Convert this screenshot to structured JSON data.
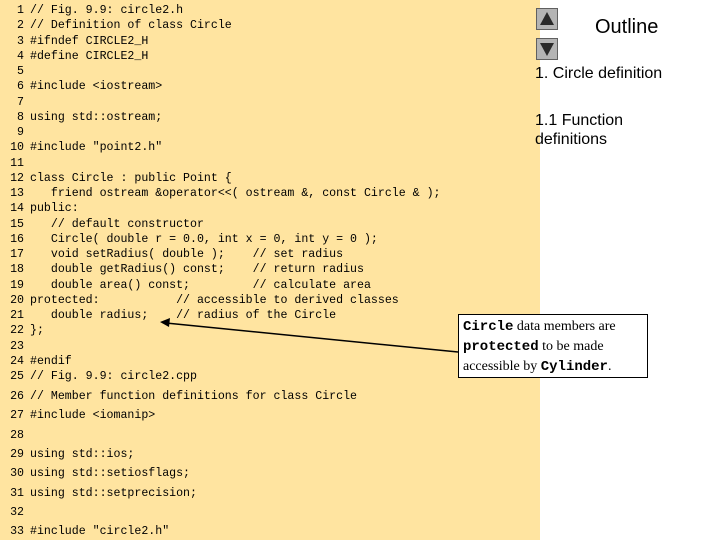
{
  "code": {
    "lines": [
      {
        "n": "1",
        "t": "// Fig. 9.9: circle2.h"
      },
      {
        "n": "2",
        "t": "// Definition of class Circle"
      },
      {
        "n": "3",
        "t": "#ifndef CIRCLE2_H"
      },
      {
        "n": "4",
        "t": "#define CIRCLE2_H"
      },
      {
        "n": "5",
        "t": ""
      },
      {
        "n": "6",
        "t": "#include <iostream>"
      },
      {
        "n": "7",
        "t": ""
      },
      {
        "n": "8",
        "t": "using std::ostream;"
      },
      {
        "n": "9",
        "t": ""
      },
      {
        "n": "10",
        "t": "#include \"point2.h\""
      },
      {
        "n": "11",
        "t": ""
      },
      {
        "n": "12",
        "t": "class Circle : public Point {"
      },
      {
        "n": "13",
        "t": "   friend ostream &operator<<( ostream &, const Circle & );"
      },
      {
        "n": "14",
        "t": "public:"
      },
      {
        "n": "15",
        "t": "   // default constructor"
      },
      {
        "n": "16",
        "t": "   Circle( double r = 0.0, int x = 0, int y = 0 );"
      },
      {
        "n": "17",
        "t": "   void setRadius( double );    // set radius"
      },
      {
        "n": "18",
        "t": "   double getRadius() const;    // return radius"
      },
      {
        "n": "19",
        "t": "   double area() const;         // calculate area"
      },
      {
        "n": "20",
        "t": "protected:           // accessible to derived classes"
      },
      {
        "n": "21",
        "t": "   double radius;    // radius of the Circle"
      },
      {
        "n": "22",
        "t": "};"
      },
      {
        "n": "23",
        "t": ""
      },
      {
        "n": "24",
        "t": "#endif"
      },
      {
        "n": "25",
        "t": "// Fig. 9.9: circle2.cpp"
      },
      {
        "n": "26",
        "t": "// Member function definitions for class Circle"
      },
      {
        "n": "27",
        "t": "#include <iomanip>"
      },
      {
        "n": "28",
        "t": ""
      },
      {
        "n": "29",
        "t": "using std::ios;"
      },
      {
        "n": "30",
        "t": "using std::setiosflags;"
      },
      {
        "n": "31",
        "t": "using std::setprecision;"
      },
      {
        "n": "32",
        "t": ""
      },
      {
        "n": "33",
        "t": "#include \"circle2.h\""
      }
    ]
  },
  "outline": {
    "title": "Outline",
    "item1": "1. Circle definition",
    "item2": "1.1 Function definitions",
    "nav_up": "up-arrow-icon",
    "nav_down": "down-arrow-icon"
  },
  "callout": {
    "part1": "Circle",
    "part2": " data members are ",
    "part3": "protected",
    "part4": " to be made accessible by ",
    "part5": "Cylinder",
    "part6": "."
  },
  "colors": {
    "code_background": "#ffe4a0",
    "keyword": "#0000a0"
  }
}
